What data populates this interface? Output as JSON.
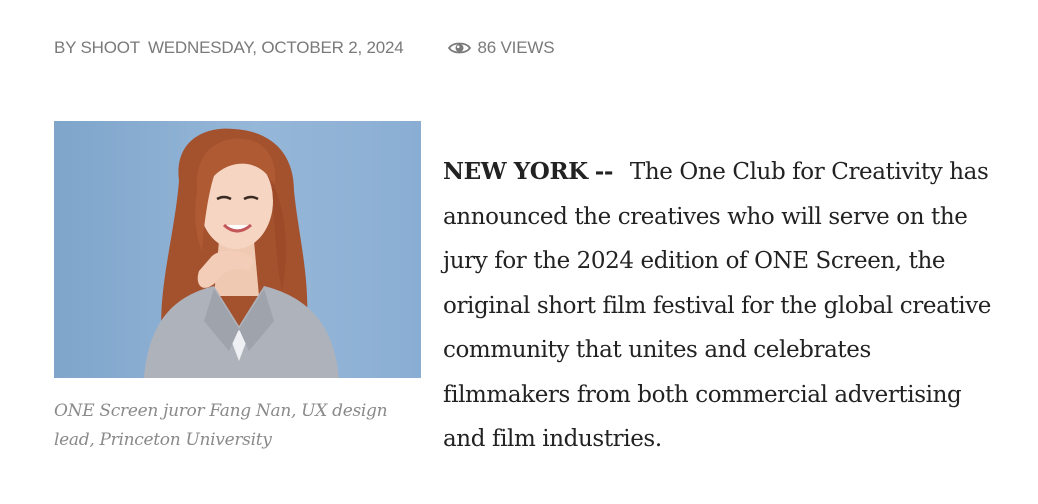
{
  "meta": {
    "byline": "BY SHOOT",
    "date": "WEDNESDAY, OCTOBER 2, 2024",
    "views": "86 VIEWS",
    "views_icon": "eye-icon"
  },
  "photo": {
    "caption": "ONE Screen juror Fang Nan, UX design lead, Princeton University"
  },
  "article": {
    "dateline": "NEW YORK",
    "dash": "--",
    "text": "The One Club for Creativity has announced the creatives who will serve on the jury for the 2024 edition of ONE Screen, the original short film festival for the global creative community that unites and celebrates filmmakers from both commercial advertising and film industries."
  }
}
